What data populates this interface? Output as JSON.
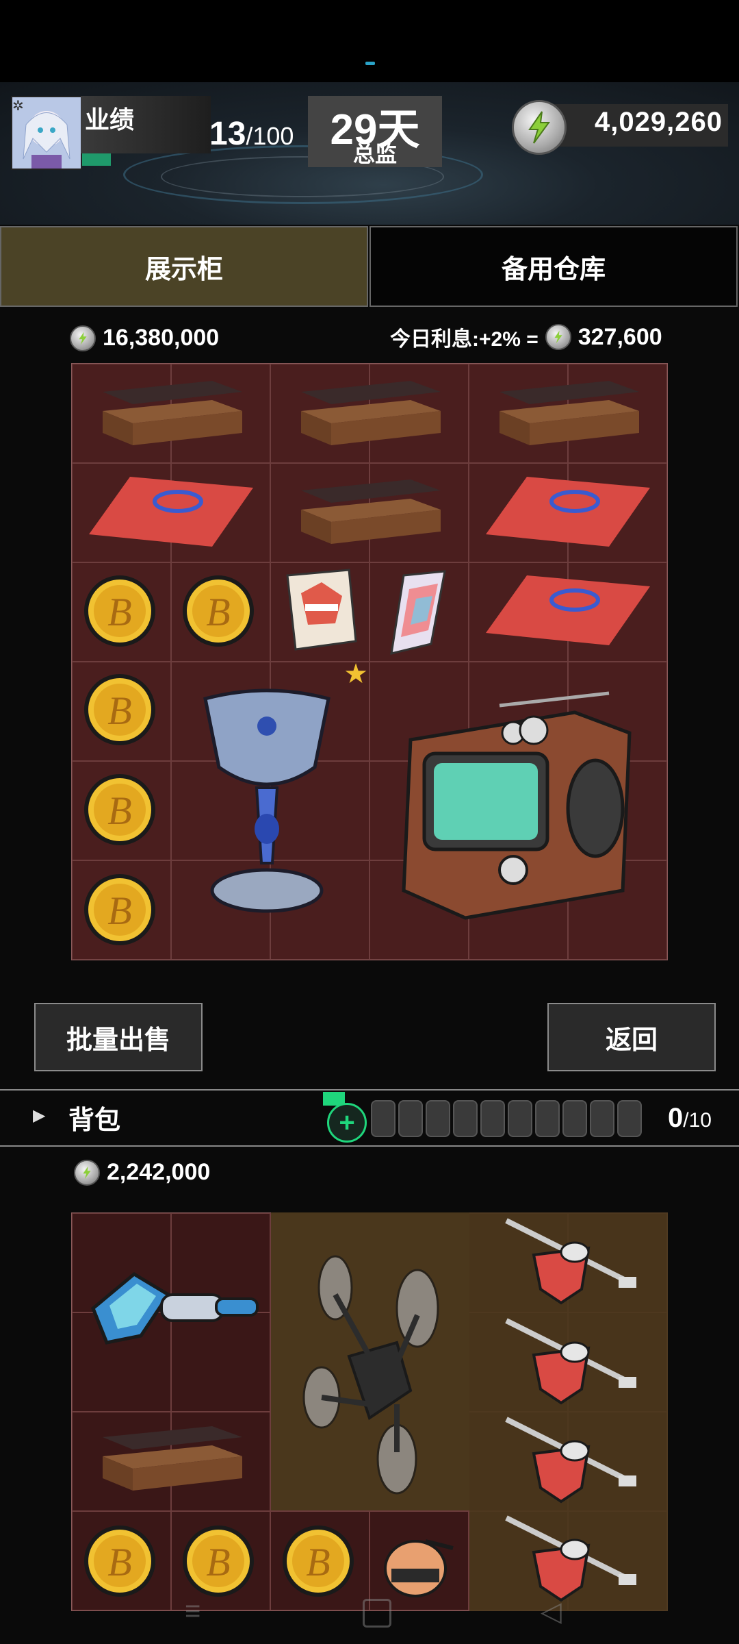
{
  "header": {
    "perf_label": "业绩",
    "perf_current": "13",
    "perf_total": "/100",
    "days": "29天",
    "rank": "总监",
    "money": "4,029,260"
  },
  "tabs": [
    {
      "label": "展示柜",
      "active": true
    },
    {
      "label": "备用仓库",
      "active": false
    }
  ],
  "cabinet": {
    "value": "16,380,000",
    "interest_label": "今日利息:+2% =",
    "interest_value": "327,600"
  },
  "buttons": {
    "bulk_sell": "批量出售",
    "back": "返回"
  },
  "backpack": {
    "label": "背包",
    "count": "0",
    "capacity": "/10",
    "value": "2,242,000"
  },
  "colors": {
    "accent_green": "#1fd67c",
    "tab_active": "#4b4326",
    "cabinet_bg": "#4a1e1e",
    "bag_brown": "#4a371c"
  },
  "icons": [
    "lightning-coin-icon",
    "gear-icon",
    "bitcoin-icon",
    "chevron-right-icon",
    "plus-icon"
  ]
}
